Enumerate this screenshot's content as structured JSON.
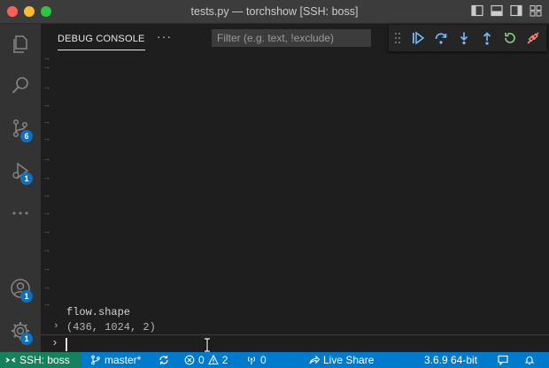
{
  "window": {
    "title": "tests.py — torchshow [SSH: boss]"
  },
  "activity_bar": {
    "scm_badge": "6",
    "debug_badge": "1",
    "accounts_badge": "1",
    "settings_badge": "1"
  },
  "panel": {
    "tab_label": "DEBUG CONSOLE",
    "more_label": "···",
    "filter_placeholder": "Filter (e.g. text, !exclude)"
  },
  "console": {
    "arrows": [
      "→",
      "→",
      "→",
      "→",
      "→",
      "→",
      "→",
      "→",
      "→",
      "→",
      "→",
      "→",
      "→",
      "→",
      "→"
    ],
    "expression": "flow.shape",
    "result": "(436, 1024, 2)",
    "expand_chevron": "›",
    "prompt": "›"
  },
  "statusbar": {
    "remote_label": "SSH: boss",
    "branch": "master*",
    "errors": "0",
    "warnings": "2",
    "ports": "0",
    "live_share": "Live Share",
    "python_version": "3.6.9 64-bit"
  },
  "colors": {
    "statusbar": "#007acc",
    "remote": "#16825d",
    "badge": "#0e70c0",
    "debug_continue": "#75beff",
    "debug_restart": "#89d185",
    "debug_disconnect": "#f48771"
  }
}
